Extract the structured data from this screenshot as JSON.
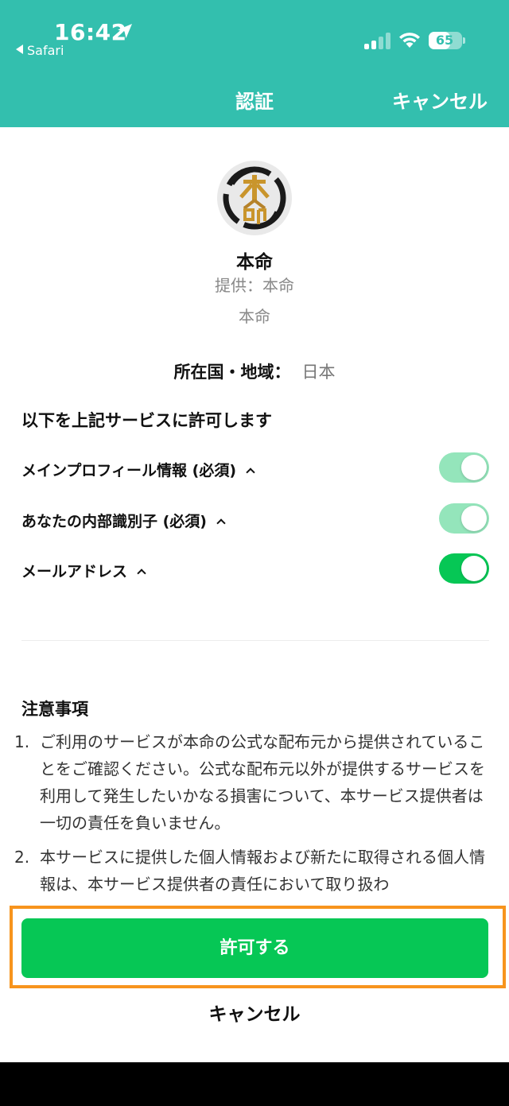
{
  "colors": {
    "accent": "#33bfae",
    "toggle_on": "#06c755",
    "toggle_disabled": "#94e5bb",
    "highlight": "#f7941d"
  },
  "status_bar": {
    "time": "16:42",
    "back_app": "Safari",
    "battery": "65",
    "location_icon": "location-arrow-icon",
    "signal_icon": "cellular-signal-icon",
    "wifi_icon": "wifi-icon"
  },
  "nav": {
    "title": "認証",
    "cancel": "キャンセル"
  },
  "app": {
    "name": "本命",
    "provider": "提供：本命",
    "subtitle": "本命"
  },
  "region": {
    "label": "所在国・地域：",
    "value": "日本"
  },
  "permissions": {
    "heading": "以下を上記サービスに許可します",
    "items": [
      {
        "label": "メインプロフィール情報 (必須)",
        "state": "required-on"
      },
      {
        "label": "あなたの内部識別子 (必須)",
        "state": "required-on"
      },
      {
        "label": "メールアドレス",
        "state": "on"
      }
    ]
  },
  "notes": {
    "title": "注意事項",
    "items": [
      {
        "num": "1.",
        "text": "ご利用のサービスが本命の公式な配布元から提供されていることをご確認ください。公式な配布元以外が提供するサービスを利用して発生したいかなる損害について、本サービス提供者は一切の責任を負いません。"
      },
      {
        "num": "2.",
        "text": "本サービスに提供した個人情報および新たに取得される個人情報は、本サービス提供者の責任において取り扱わ"
      }
    ]
  },
  "actions": {
    "allow": "許可する",
    "cancel": "キャンセル"
  }
}
